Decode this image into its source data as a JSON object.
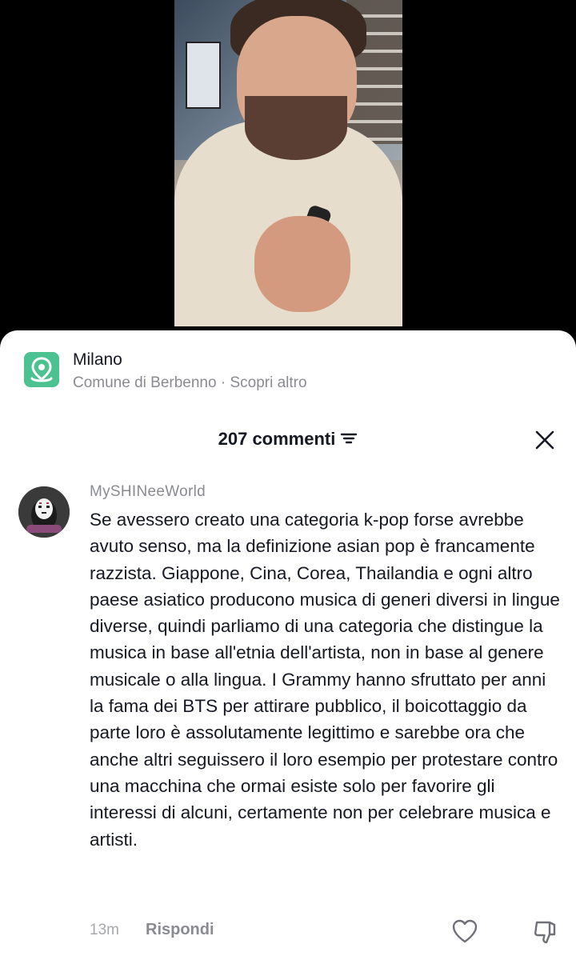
{
  "location": {
    "title": "Milano",
    "subtitle": "Comune di Berbenno · Scopri altro"
  },
  "comments_header": {
    "title": "207 commenti"
  },
  "comment": {
    "username": "MySHINeeWorld",
    "text": "Se avessero creato una categoria k-pop forse avrebbe avuto senso, ma la definizione asian pop è francamente razzista. Giappone, Cina, Corea, Thailandia e ogni altro paese asiatico producono musica di generi diversi in lingue diverse, quindi parliamo di una categoria che distingue la musica in base all'etnia dell'artista, non in base al genere musicale o alla lingua. I Grammy hanno sfruttato per anni la fama dei BTS per attirare pubblico, il boicottaggio da parte loro è assolutamente legittimo e sarebbe ora che anche altri seguissero il loro esempio per protestare contro una macchina che ormai esiste solo per favorire gli interessi di alcuni, certamente non per celebrare musica e artisti.",
    "time": "13m",
    "reply_label": "Rispondi"
  },
  "icons": {
    "location": "location-pin-icon",
    "sort": "sort-icon",
    "close": "close-icon",
    "like": "heart-icon",
    "dislike": "thumbs-down-icon"
  },
  "colors": {
    "location_accent": "#4bc28f",
    "text_primary": "#161823",
    "text_secondary": "#8a8b91"
  }
}
